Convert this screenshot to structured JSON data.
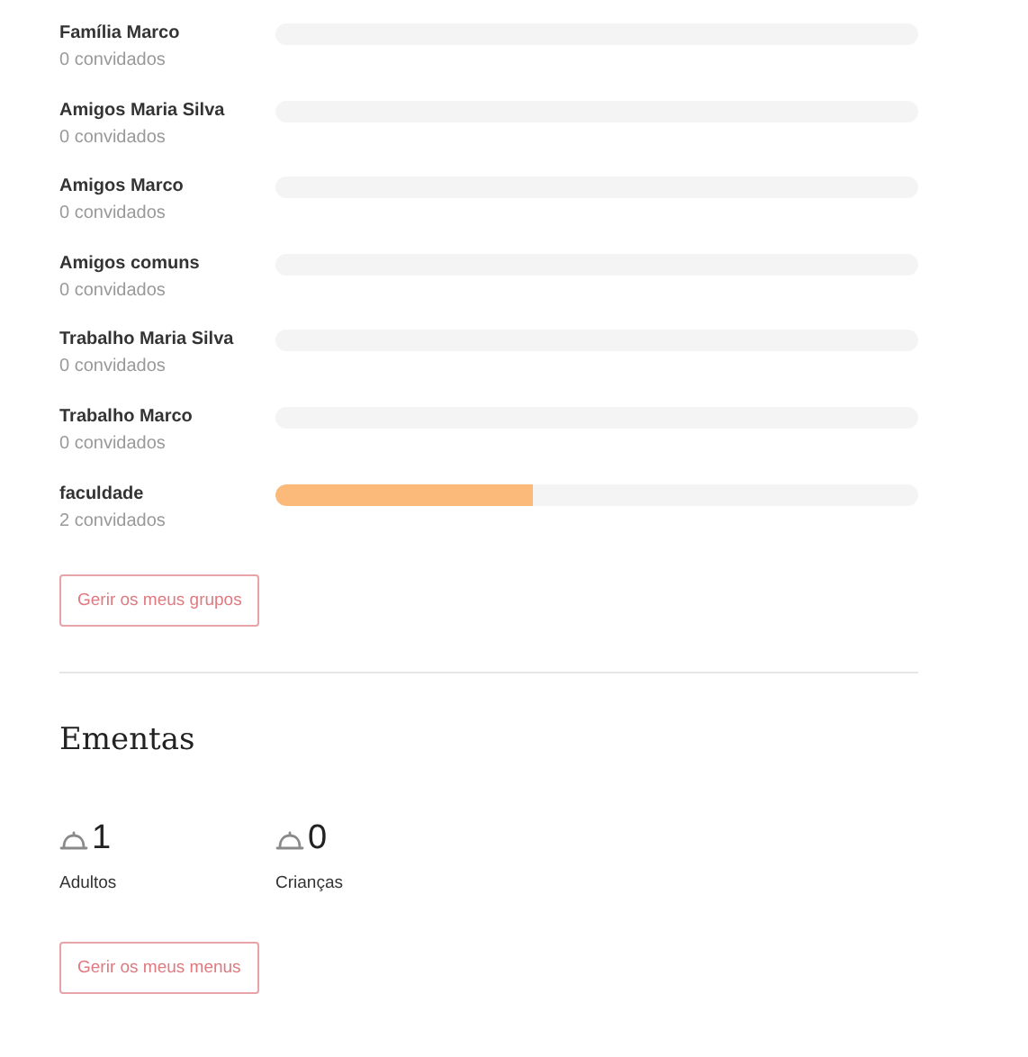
{
  "groups": [
    {
      "name": "Família Marco",
      "count": "0 convidados",
      "level": 0
    },
    {
      "name": "Amigos Maria Silva",
      "count": "0 convidados",
      "level": 0
    },
    {
      "name": "Amigos Marco",
      "count": "0 convidados",
      "level": 0
    },
    {
      "name": "Amigos comuns",
      "count": "0 convidados",
      "level": 0
    },
    {
      "name": "Trabalho Maria Silva",
      "count": "0 convidados",
      "level": 0
    },
    {
      "name": "Trabalho Marco",
      "count": "0 convidados",
      "level": 0
    },
    {
      "name": "faculdade",
      "count": "2 convidados",
      "level": 0.4
    }
  ],
  "groups_button": "Gerir os meus grupos",
  "menus": {
    "title": "Ementas",
    "stats": [
      {
        "value": "1",
        "label": "Adultos"
      },
      {
        "value": "0",
        "label": "Crianças"
      }
    ],
    "button": "Gerir os meus menus"
  }
}
